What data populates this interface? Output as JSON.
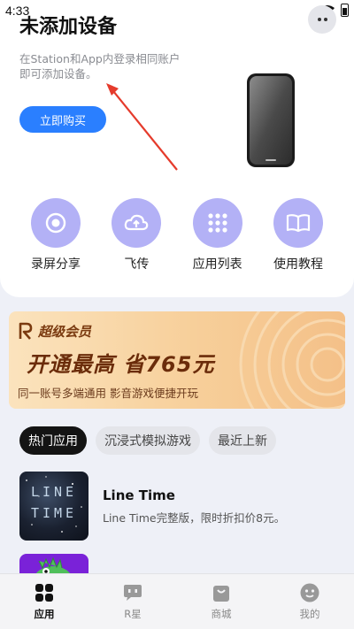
{
  "status": {
    "time": "4:33"
  },
  "header": {
    "title": "未添加设备",
    "subtitle_line1": "在Station和App内登录相同账户",
    "subtitle_line2": "即可添加设备。",
    "buy_label": "立即购买"
  },
  "quick_actions": [
    {
      "label": "录屏分享",
      "icon": "record-screen-icon"
    },
    {
      "label": "飞传",
      "icon": "cloud-upload-icon"
    },
    {
      "label": "应用列表",
      "icon": "app-grid-icon"
    },
    {
      "label": "使用教程",
      "icon": "book-icon"
    }
  ],
  "vip": {
    "title": "超级会员",
    "headline": "开通最高 省765元",
    "subtitle": "同一账号多端通用 影音游戏便捷开玩"
  },
  "tabs": [
    {
      "label": "热门应用",
      "active": true
    },
    {
      "label": "沉浸式模拟游戏",
      "active": false
    },
    {
      "label": "最近上新",
      "active": false
    }
  ],
  "apps": [
    {
      "name": "Line Time",
      "desc": "Line Time完整版，限时折扣价8元。",
      "thumb_line1": "LINE",
      "thumb_line2": "TIME"
    }
  ],
  "nav": [
    {
      "label": "应用",
      "active": true,
      "icon": "apps-icon"
    },
    {
      "label": "R星",
      "active": false,
      "icon": "chat-icon"
    },
    {
      "label": "商城",
      "active": false,
      "icon": "shopping-bag-icon"
    },
    {
      "label": "我的",
      "active": false,
      "icon": "profile-icon"
    }
  ],
  "colors": {
    "accent": "#2a7fff",
    "icon_bg": "#b3b1f6",
    "arrow": "#e53b2c"
  }
}
